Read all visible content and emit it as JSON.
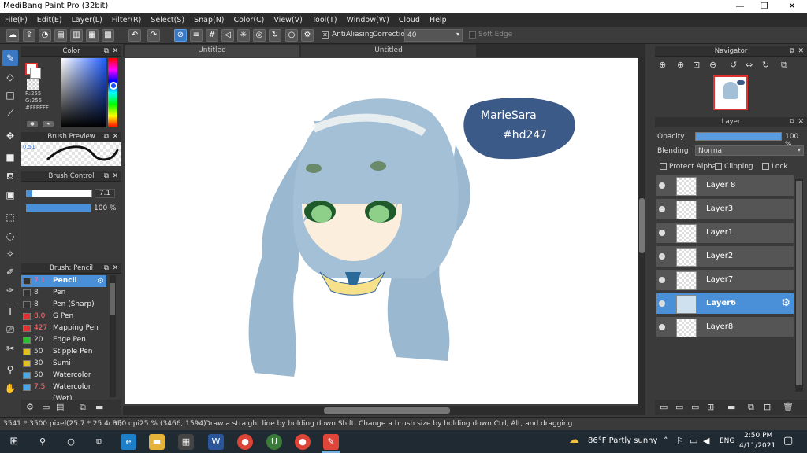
{
  "window": {
    "title": "MediBang Paint Pro (32bit)",
    "minimize": "—",
    "maximize": "❐",
    "close": "✕"
  },
  "menu": [
    "File(F)",
    "Edit(E)",
    "Layer(L)",
    "Filter(R)",
    "Select(S)",
    "Snap(N)",
    "Color(C)",
    "View(V)",
    "Tool(T)",
    "Window(W)",
    "Cloud",
    "Help"
  ],
  "toolbar": {
    "antialiasing": "AntiAliasing",
    "correction_label": "Correction",
    "correction_value": "40",
    "soft_edge": "Soft Edge"
  },
  "tabs": [
    "Untitled",
    "Untitled"
  ],
  "color_panel": {
    "title": "Color",
    "r": "R:255",
    "g": "G:255",
    "b": "B:255",
    "hex": "#FFFFFF"
  },
  "brush_preview": {
    "title": "Brush Preview",
    "size": "0.51"
  },
  "brush_control": {
    "title": "Brush Control",
    "size_value": "7.1",
    "opacity_value": "100 %"
  },
  "brush_list": {
    "title": "Brush: Pencil",
    "items": [
      {
        "size": "7.1",
        "name": "Pencil",
        "color": "#333333"
      },
      {
        "size": "8",
        "name": "Pen",
        "color": "#333333"
      },
      {
        "size": "8",
        "name": "Pen (Sharp)",
        "color": "#333333"
      },
      {
        "size": "8.0",
        "name": "G Pen",
        "color": "#e03030"
      },
      {
        "size": "427",
        "name": "Mapping Pen",
        "color": "#e03030"
      },
      {
        "size": "20",
        "name": "Edge Pen",
        "color": "#30c030"
      },
      {
        "size": "50",
        "name": "Stipple Pen",
        "color": "#e0c020"
      },
      {
        "size": "30",
        "name": "Sumi",
        "color": "#e0c020"
      },
      {
        "size": "50",
        "name": "Watercolor",
        "color": "#4aa8e8"
      },
      {
        "size": "7.5",
        "name": "Watercolor (Wet)",
        "color": "#4aa8e8"
      }
    ]
  },
  "canvas_text": {
    "line1": "MarieSara",
    "line2": "#hd247"
  },
  "navigator": {
    "title": "Navigator"
  },
  "layer_panel": {
    "title": "Layer",
    "opacity_label": "Opacity",
    "opacity_value": "100 %",
    "opacity_fraction": 1.0,
    "blending_label": "Blending",
    "blending_value": "Normal",
    "protect_alpha": "Protect Alpha",
    "clipping": "Clipping",
    "lock": "Lock",
    "layers": [
      "Layer 8",
      "Layer3",
      "Layer1",
      "Layer2",
      "Layer7",
      "Layer6",
      "Layer8"
    ],
    "selected_index": 5
  },
  "status": {
    "dimensions": "3541 * 3500 pixel",
    "physical": "(25.7 * 25.4cm)",
    "dpi": "350 dpi",
    "zoom": "25 %",
    "coords": "(3466, 1594)",
    "hint": "Draw a straight line by holding down Shift, Change a brush size by holding down Ctrl, Alt, and dragging"
  },
  "taskbar": {
    "weather": "86°F  Partly sunny",
    "lang": "ENG",
    "time": "2:50 PM",
    "date": "4/11/2021"
  }
}
